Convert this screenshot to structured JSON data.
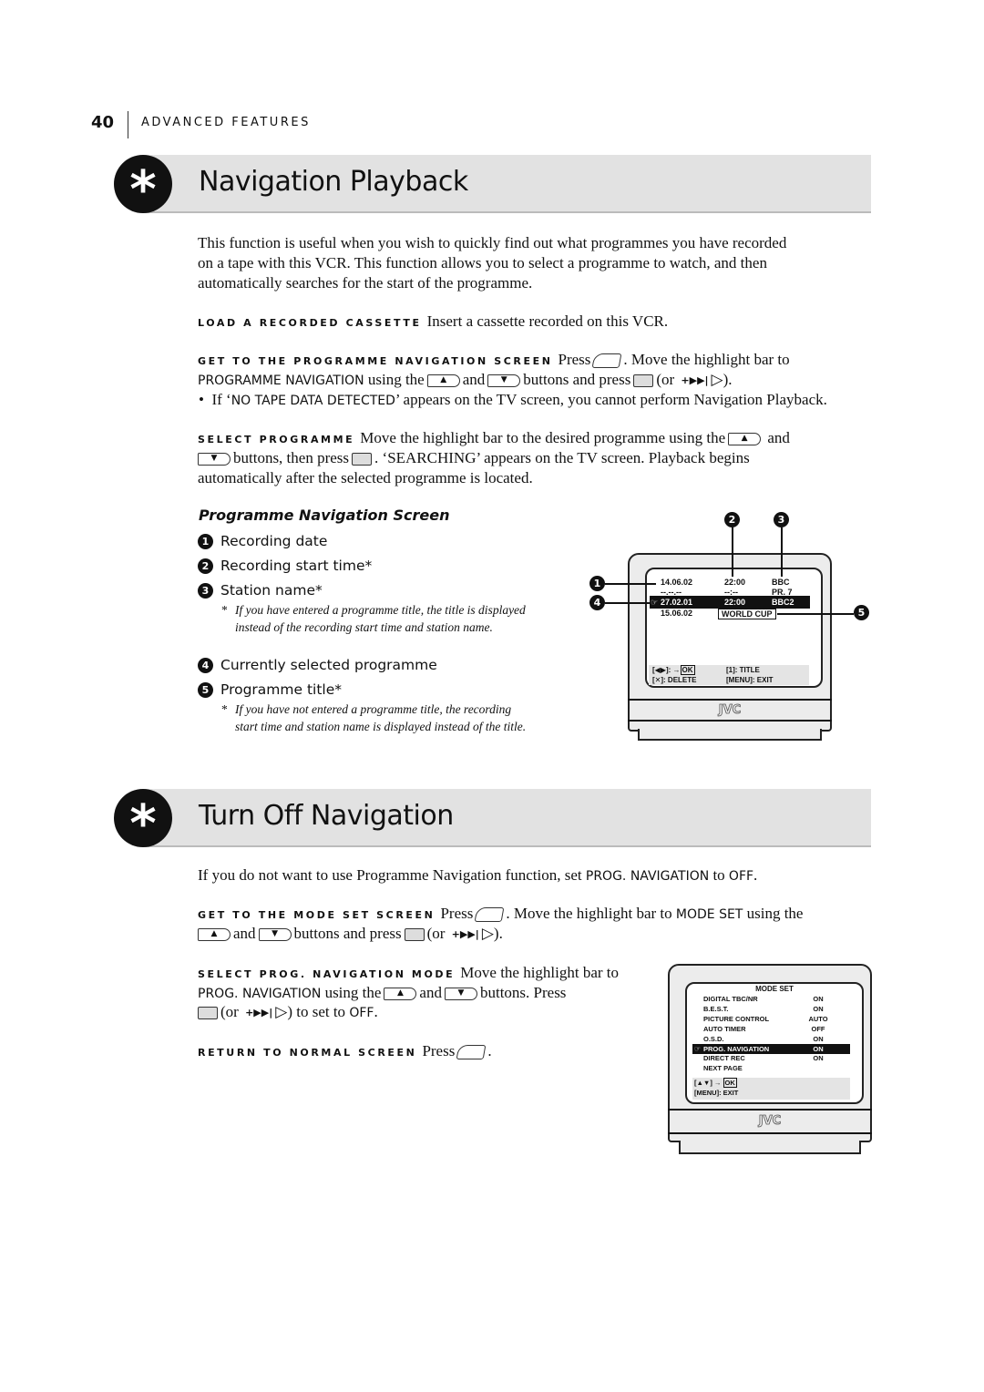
{
  "header": {
    "page_number": "40",
    "section": "ADVANCED FEATURES"
  },
  "section1": {
    "title": "Navigation Playback",
    "intro": [
      "This function is useful when you wish to quickly find out what programmes you have recorded",
      "on a tape with this VCR. This function allows you to select a programme to watch, and then",
      "automatically searches for the start of the programme."
    ],
    "step1": {
      "label": "LOAD A RECORDED CASSETTE",
      "text": "Insert a cassette recorded on this VCR."
    },
    "step2": {
      "label": "GET TO THE PROGRAMME NAVIGATION SCREEN",
      "press": "Press",
      "t1": ". Move the highlight bar to",
      "key": "PROGRAMME NAVIGATION",
      "t2": "using the",
      "and": "and",
      "t3": "buttons and press",
      "or": "(or",
      "close": ").",
      "bullet": "•",
      "b1": "If ‘",
      "bkey": "NO TAPE DATA DETECTED",
      "b2": "’ appears on the TV screen, you cannot perform Navigation Playback."
    },
    "step3": {
      "label": "SELECT PROGRAMME",
      "t1": "Move the highlight bar to the desired programme using the",
      "and": "and",
      "t2": "buttons, then press",
      "t3": ". ‘SEARCHING’ appears on the TV screen. Playback begins",
      "t4": "automatically after the selected programme is located."
    },
    "subheading": "Programme Navigation Screen",
    "legend": [
      {
        "n": "1",
        "text": "Recording date"
      },
      {
        "n": "2",
        "text": "Recording start time*"
      },
      {
        "n": "3",
        "text": "Station name*"
      },
      {
        "n": "4",
        "text": "Currently selected programme"
      },
      {
        "n": "5",
        "text": "Programme title*"
      }
    ],
    "note1": "If you have entered a programme title, the title is displayed instead of the recording start time and station name.",
    "note2": "If you have not entered a programme title, the recording start time and station name is displayed instead of the title.",
    "asterisk": "*",
    "tv": {
      "rows": [
        [
          "14.06.02",
          "22:00",
          "BBC"
        ],
        [
          "--.--.--",
          "--:--",
          "PR. 7"
        ],
        [
          "27.02.01",
          "22:00",
          "BBC2"
        ],
        [
          "15.06.02",
          "WORLD CUP",
          ""
        ]
      ],
      "selected_row": 2,
      "footer": [
        "[◀▶]: →",
        "OK",
        "[1]: TITLE",
        "[✕]: DELETE",
        "[MENU]: EXIT"
      ],
      "brand": "JVC"
    }
  },
  "section2": {
    "title": "Turn Off Navigation",
    "intro": {
      "t1": "If you do not want to use Programme Navigation function, set",
      "key": "PROG. NAVIGATION",
      "t2": "to",
      "val": "OFF",
      "end": "."
    },
    "step1": {
      "label": "GET TO THE MODE SET SCREEN",
      "press": "Press",
      "t1": ". Move the highlight bar to",
      "key": "MODE SET",
      "t2": "using the",
      "and": "and",
      "t3": "buttons and press",
      "or": "(or",
      "close": ")."
    },
    "step2": {
      "label": "SELECT PROG. NAVIGATION MODE",
      "t1": "Move the highlight bar to",
      "key": "PROG. NAVIGATION",
      "t2": "using the",
      "and": "and",
      "t3": "buttons. Press",
      "or": "(or",
      "t4": ") to set to",
      "val": "OFF",
      "end": "."
    },
    "step3": {
      "label": "RETURN TO NORMAL SCREEN",
      "press": "Press",
      "end": "."
    },
    "tv": {
      "title": "MODE SET",
      "rows": [
        [
          "DIGITAL TBC/NR",
          "ON"
        ],
        [
          "B.E.S.T.",
          "ON"
        ],
        [
          "PICTURE CONTROL",
          "AUTO"
        ],
        [
          "AUTO TIMER",
          "OFF"
        ],
        [
          "O.S.D.",
          "ON"
        ],
        [
          "PROG. NAVIGATION",
          "ON"
        ],
        [
          "DIRECT REC",
          "ON"
        ],
        [
          "NEXT PAGE",
          ""
        ]
      ],
      "selected_row": 5,
      "footer": [
        "[▲▼] →",
        "OK",
        "[MENU]: EXIT"
      ],
      "brand": "JVC"
    }
  },
  "icons": {
    "up": "▲",
    "down": "▼",
    "play": "+▶▶|",
    "right": "▷",
    "pointer": "☞"
  }
}
